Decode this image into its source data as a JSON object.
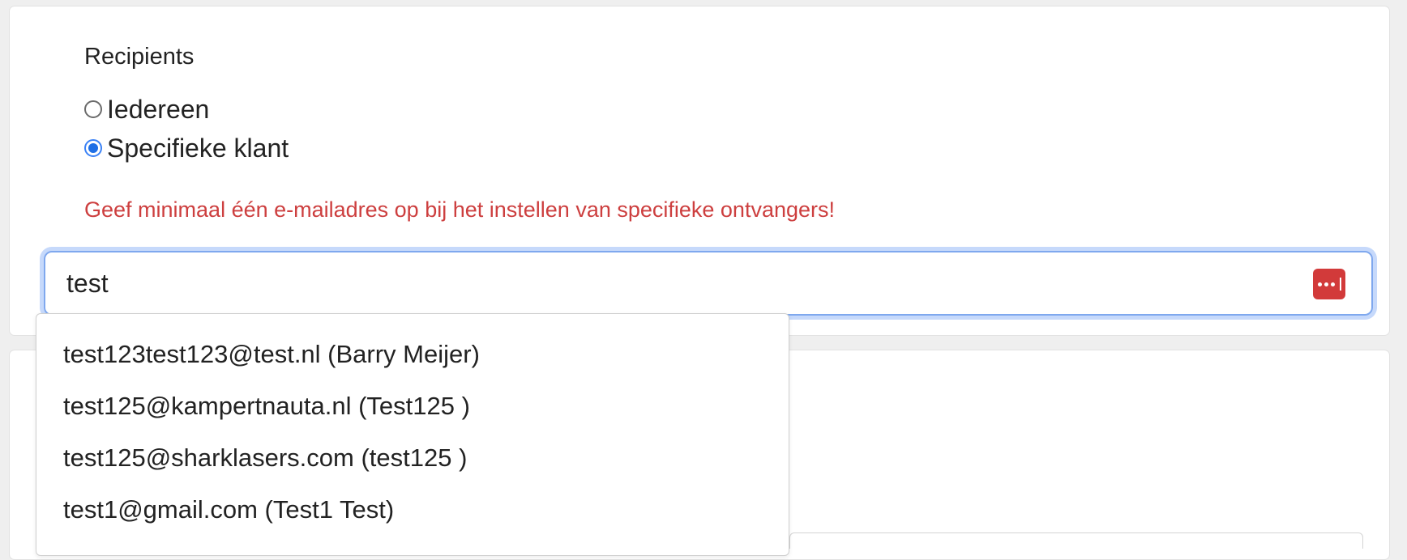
{
  "recipients": {
    "title": "Recipients",
    "options": [
      {
        "label": "Iedereen",
        "checked": false
      },
      {
        "label": "Specifieke klant",
        "checked": true
      }
    ],
    "error": "Geef minimaal één e-mailadres op bij het instellen van specifieke ontvangers!"
  },
  "search": {
    "value": "test",
    "password_manager_icon": "password-manager-icon",
    "password_manager_color": "#d23a3a"
  },
  "suggestions": [
    "test123test123@test.nl (Barry Meijer)",
    "test125@kampertnauta.nl (Test125 )",
    "test125@sharklasers.com (test125 )",
    "test1@gmail.com (Test1 Test)"
  ],
  "colors": {
    "error": "#cd3f3f",
    "focus_ring": "#c6d9fb",
    "radio_selected": "#1f6fe5"
  }
}
